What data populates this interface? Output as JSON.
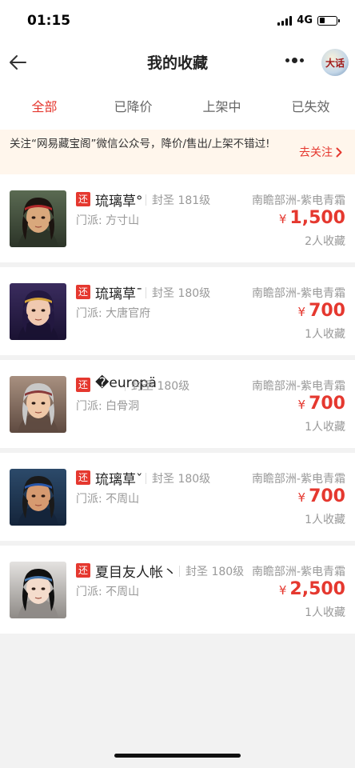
{
  "status": {
    "time": "01:15",
    "network": "4G"
  },
  "nav": {
    "title": "我的收藏",
    "logo_text": "大话"
  },
  "tabs": [
    {
      "label": "全部",
      "active": true
    },
    {
      "label": "已降价",
      "active": false
    },
    {
      "label": "上架中",
      "active": false
    },
    {
      "label": "已失效",
      "active": false
    }
  ],
  "notice": {
    "text": "关注“网易藏宝阁”微信公众号，降价/售出/上架不错过!",
    "action": "去关注"
  },
  "items": [
    {
      "tag": "还",
      "name": "琉璃草°",
      "level": "封圣 181级",
      "server": "南瞻部洲-紫电青霜",
      "school": "门派: 方寸山",
      "price": "1,500",
      "currency": "¥",
      "favorites": "2人收藏"
    },
    {
      "tag": "还",
      "name": "琉璃草¯",
      "level": "封圣 180级",
      "server": "南瞻部洲-紫电青霜",
      "school": "门派: 大唐官府",
      "price": "700",
      "currency": "¥",
      "favorites": "1人收藏"
    },
    {
      "tag": "还",
      "name": "�europä",
      "level": "封圣 180级",
      "server": "南瞻部洲-紫电青霜",
      "school": "门派: 白骨洞",
      "price": "700",
      "currency": "¥",
      "favorites": "1人收藏"
    },
    {
      "tag": "还",
      "name": "琉璃草ˇ",
      "level": "封圣 180级",
      "server": "南瞻部洲-紫电青霜",
      "school": "门派: 不周山",
      "price": "700",
      "currency": "¥",
      "favorites": "1人收藏"
    },
    {
      "tag": "还",
      "name": "夏目友人帐丶",
      "level": "封圣 180级",
      "server": "南瞻部洲-紫电青霜",
      "school": "门派: 不周山",
      "price": "2,500",
      "currency": "¥",
      "favorites": "1人收藏"
    }
  ],
  "colors": {
    "accent": "#e5382f",
    "notice_bg": "#fff6ec"
  }
}
